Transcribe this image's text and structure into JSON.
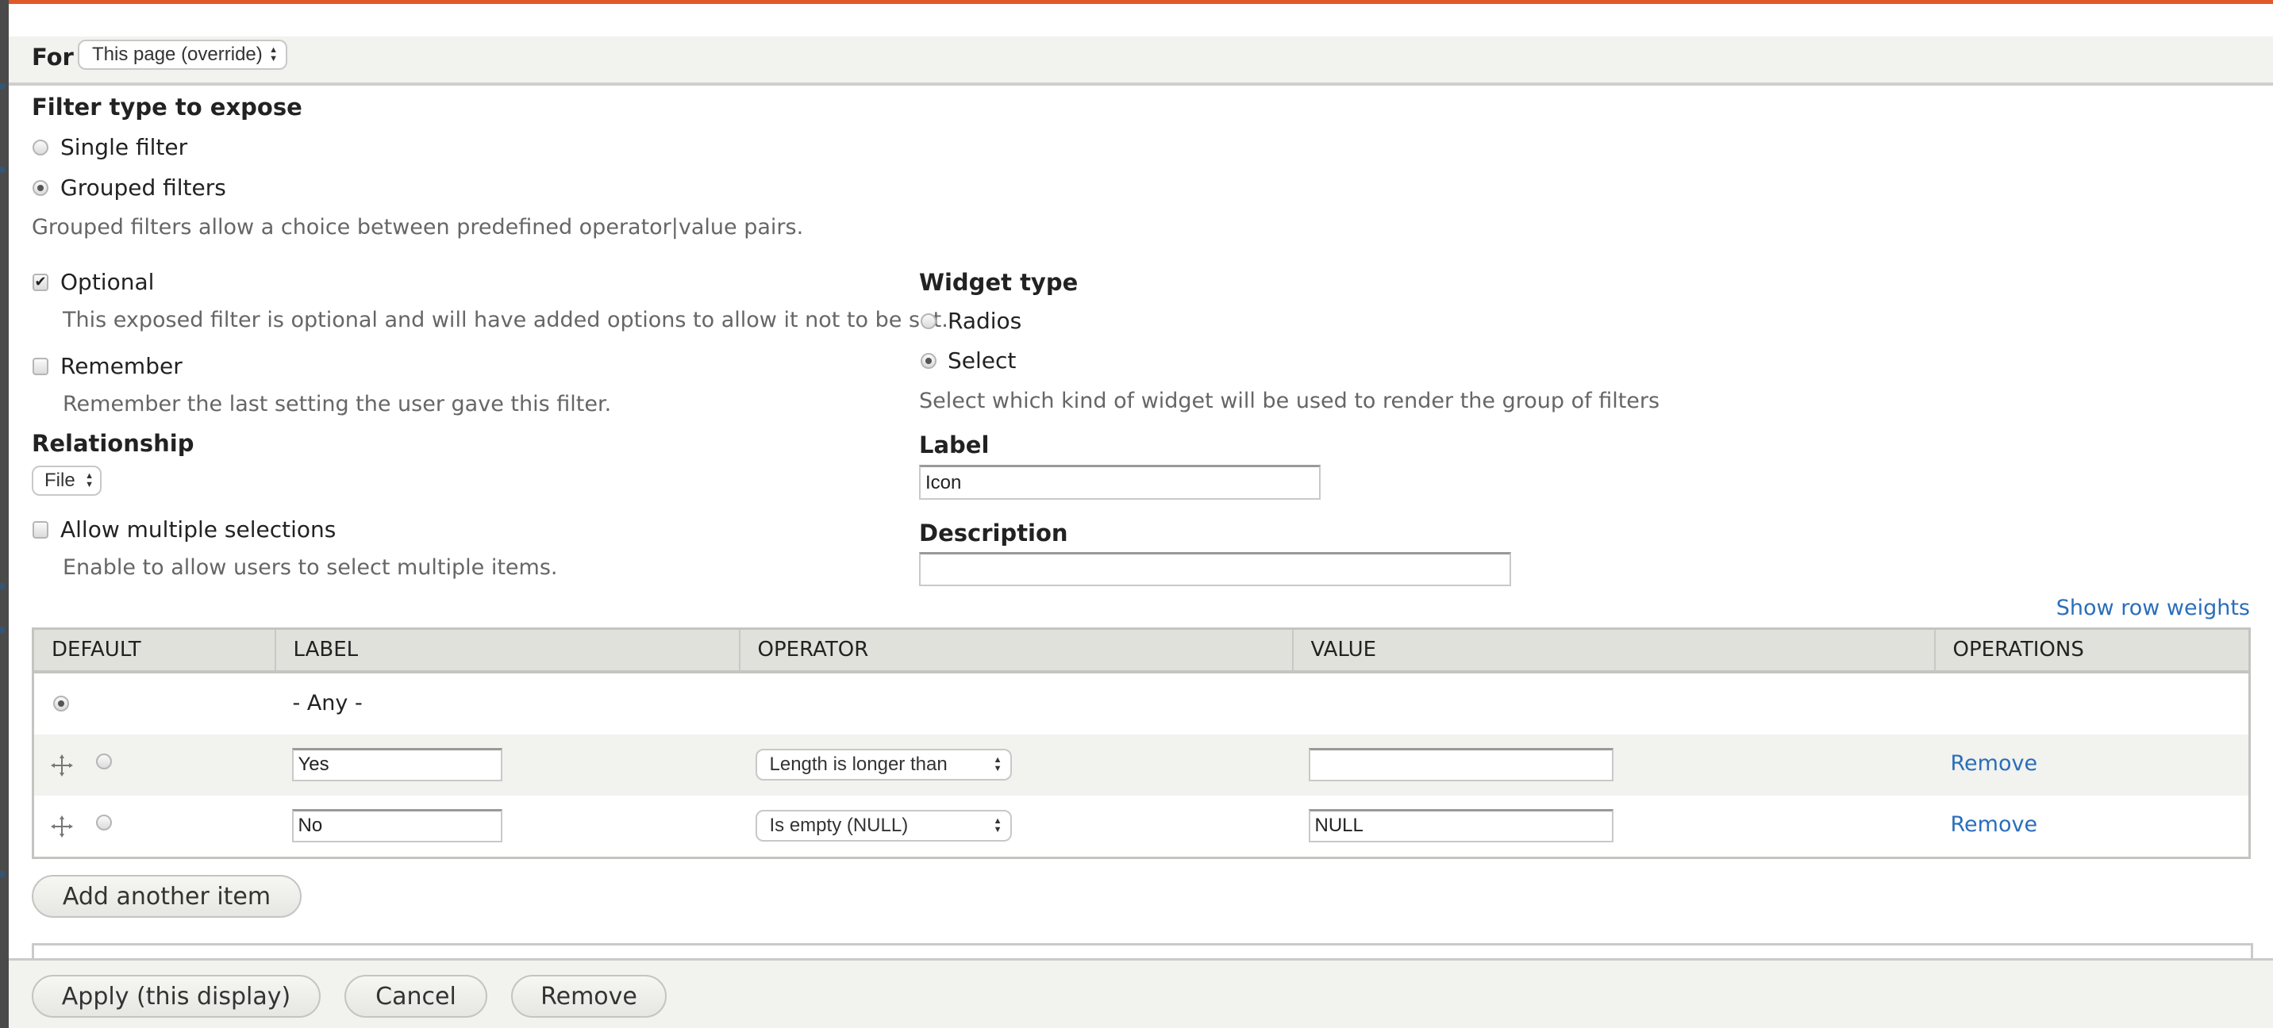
{
  "for_bar": {
    "label": "For",
    "select_value": "This page (override)"
  },
  "filter_type": {
    "heading": "Filter type to expose",
    "options": [
      {
        "label": "Single filter",
        "selected": false
      },
      {
        "label": "Grouped filters",
        "selected": true
      }
    ],
    "description": "Grouped filters allow a choice between predefined operator|value pairs."
  },
  "optional": {
    "label": "Optional",
    "checked": true,
    "description": "This exposed filter is optional and will have added options to allow it not to be set."
  },
  "remember": {
    "label": "Remember",
    "checked": false,
    "description": "Remember the last setting the user gave this filter."
  },
  "relationship": {
    "heading": "Relationship",
    "select_value": "File"
  },
  "allow_multiple": {
    "label": "Allow multiple selections",
    "checked": false,
    "description": "Enable to allow users to select multiple items."
  },
  "widget_type": {
    "heading": "Widget type",
    "options": [
      {
        "label": "Radios",
        "selected": false
      },
      {
        "label": "Select",
        "selected": true
      }
    ],
    "description": "Select which kind of widget will be used to render the group of filters"
  },
  "label_field": {
    "heading": "Label",
    "value": "Icon"
  },
  "description_field": {
    "heading": "Description",
    "value": ""
  },
  "show_row_weights": "Show row weights",
  "group_table": {
    "columns": [
      "DEFAULT",
      "LABEL",
      "OPERATOR",
      "VALUE",
      "OPERATIONS"
    ],
    "any_row": {
      "label": "- Any -",
      "default_selected": true
    },
    "rows": [
      {
        "label": "Yes",
        "operator": "Length is longer than",
        "value": "",
        "operation": "Remove",
        "default_selected": false
      },
      {
        "label": "No",
        "operator": "Is empty (NULL)",
        "value": "NULL",
        "operation": "Remove",
        "default_selected": false
      }
    ]
  },
  "add_another_item": "Add another item",
  "footer": {
    "apply": "Apply (this display)",
    "cancel": "Cancel",
    "remove": "Remove"
  },
  "colors": {
    "accent_border": "#e0592a",
    "link": "#2a6ebb",
    "panel_bg": "#f2f2ee",
    "header_bg": "#e1e1dc"
  }
}
